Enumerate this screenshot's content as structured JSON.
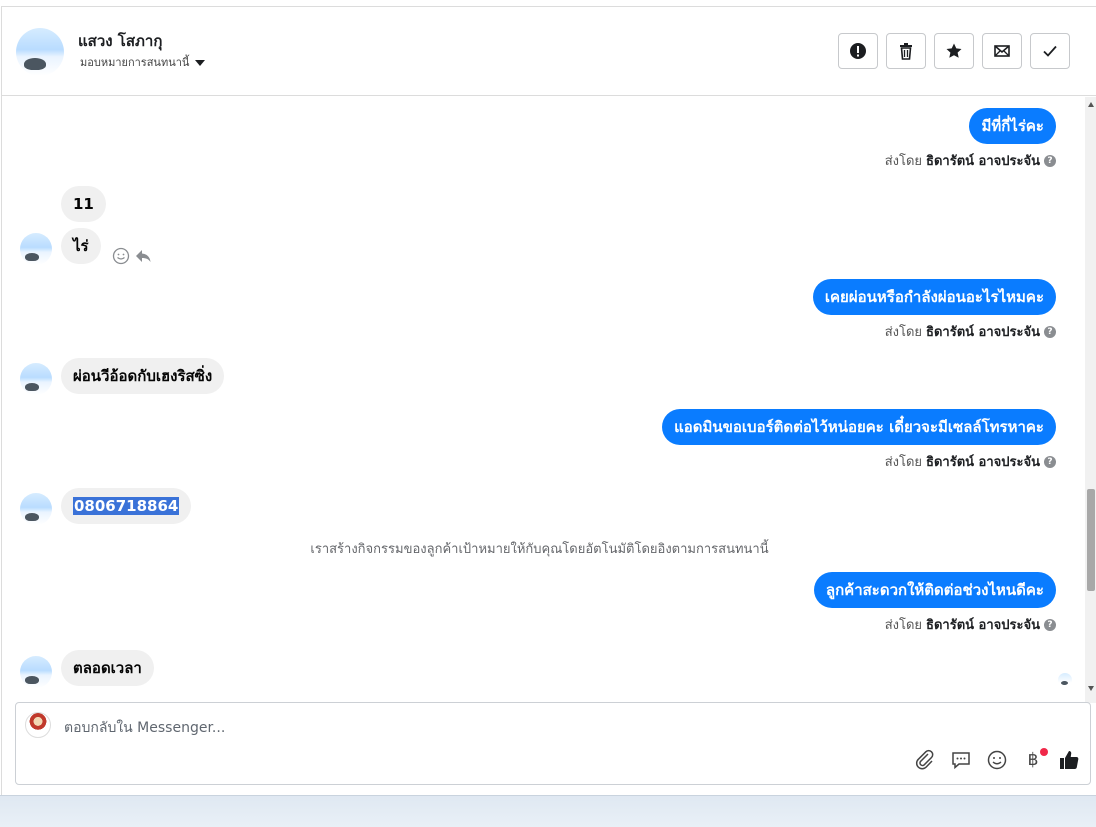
{
  "header": {
    "contact_name": "แสวง โสภากุ",
    "assign_label": "มอบหมายการสนทนานี้"
  },
  "conversation": {
    "sent_by_prefix": "ส่งโดย",
    "agent_name": "ธิดารัตน์ อาจประจัน",
    "messages": {
      "out1": "มีที่กี่ไร่คะ",
      "in1a": "11",
      "in1b": "ไร่",
      "out2": "เคยผ่อนหรือกำลังผ่อนอะไรไหมคะ",
      "in2": "ผ่อนวีอ้อดกับเฮงริสซิ่ง",
      "out3": "แอดมินขอเบอร์ติดต่อไว้หน่อยคะ เดี๋ยวจะมีเซลล์โทรหาคะ",
      "in3": "0806718864",
      "system_note": "เราสร้างกิจกรรมของลูกค้าเป้าหมายให้กับคุณโดยอัตโนมัติโดยอิงตามการสนทนานี้",
      "out4": "ลูกค้าสะดวกให้ติดต่อช่วงไหนดีคะ",
      "in4": "ตลอดเวลา"
    }
  },
  "composer": {
    "placeholder": "ตอบกลับใน Messenger...",
    "currency_symbol": "฿"
  },
  "colors": {
    "outgoing_bubble": "#0a7cff",
    "incoming_bubble": "#f0f0f0",
    "selection": "#3a72d8",
    "notification_dot": "#f02849"
  }
}
